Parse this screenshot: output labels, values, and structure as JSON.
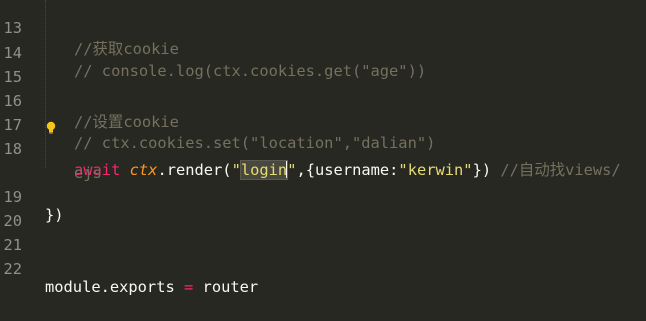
{
  "editor": {
    "lines": [
      {
        "number": "13",
        "comment": "//获取cookie"
      },
      {
        "number": "14",
        "comment": "// console.log(ctx.cookies.get(\"age\"))"
      },
      {
        "number": "16",
        "comment": "//设置cookie"
      },
      {
        "number": "17",
        "comment": "// ctx.cookies.set(\"location\",\"dalian\")"
      },
      {
        "number": "18",
        "await": "await",
        "ctx": "ctx",
        "render_call": ".render(",
        "quote_open": "\"",
        "login": "login",
        "quote_close": "\"",
        "args_mid": ",{username:",
        "kerwin": "\"kerwin\"",
        "args_end": "})",
        "comment": "//自动找views/",
        "wrap": "ejs"
      },
      {
        "number": "19",
        "code": "})"
      },
      {
        "number": "20",
        "code": ""
      },
      {
        "number": "21",
        "code": ""
      },
      {
        "number": "22",
        "module": "module.exports",
        "assign": " = ",
        "router": "router"
      }
    ]
  },
  "colors": {
    "background": "#272822",
    "comment": "#75715e",
    "keyword": "#f92672",
    "variable": "#fd971f",
    "string": "#e6db74",
    "text": "#f8f8f2",
    "line_number": "#8f908a"
  },
  "icons": {
    "lightbulb": "lightbulb-icon"
  }
}
